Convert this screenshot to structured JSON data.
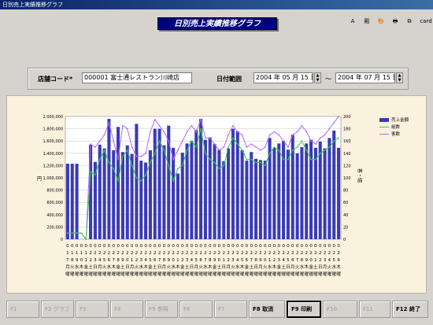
{
  "window": {
    "title": "日別売上実績推移グラフ"
  },
  "banner": "日別売上実績推移グラフ",
  "toolbar": [
    {
      "icon": "zoom-icon",
      "label": "A",
      "wide": false
    },
    {
      "icon": "font-icon",
      "label": "殿",
      "wide": false
    },
    {
      "icon": "paint-icon",
      "label": "🎨",
      "wide": false
    },
    {
      "icon": "printer-icon",
      "label": "🖶",
      "wide": false
    },
    {
      "icon": "copy-icon",
      "label": "⧉",
      "wide": false
    },
    {
      "icon": "card-icon",
      "label": "card",
      "wide": true
    }
  ],
  "filters": {
    "store_label": "店舗コード*",
    "store_value": "000001 富士通レストラン川崎店",
    "date_label": "日付範囲",
    "date_from": "2004 年 05 月 15 日",
    "tilde": "～",
    "date_to": "2004 年 07 月 15 日"
  },
  "colors": {
    "bar": "#3b3bb5",
    "line1": "#2ecc40",
    "line2": "#b266ff",
    "bg": "#fbf2de"
  },
  "chart_data": {
    "type": "bar",
    "ylabel_left": "円",
    "ylabel_right": "客・組",
    "ylim_left": [
      0,
      2000000
    ],
    "ylim_right": [
      0,
      200
    ],
    "yticks_left": [
      "0",
      "200,000",
      "400,000",
      "600,000",
      "800,000",
      "1,000,000",
      "1,200,000",
      "1,400,000",
      "1,600,000",
      "1,800,000",
      "2,000,000"
    ],
    "yticks_right": [
      "0",
      "20",
      "40",
      "60",
      "80",
      "100",
      "120",
      "140",
      "160",
      "180",
      "200"
    ],
    "legend": [
      "売上金額",
      "組数",
      "客数"
    ],
    "categories": [
      "0517",
      "0518",
      "0519",
      "0520",
      "0521",
      "0522",
      "0523",
      "0524",
      "0525",
      "0526",
      "0527",
      "0528",
      "0529",
      "0530",
      "0531",
      "0601",
      "0602",
      "0603",
      "0604",
      "0605",
      "0606",
      "0607",
      "0608",
      "0609",
      "0610",
      "0611",
      "0612",
      "0613",
      "0614",
      "0615",
      "0616",
      "0617",
      "0618",
      "0619",
      "0620",
      "0621",
      "0622",
      "0623",
      "0624",
      "0625",
      "0626",
      "0627",
      "0628",
      "0629",
      "0630",
      "0701",
      "0702",
      "0703",
      "0704",
      "0705",
      "0706",
      "0707",
      "0708",
      "0709",
      "0710",
      "0711",
      "0712",
      "0713",
      "0714",
      "0715"
    ],
    "x_labels_top": [
      "0",
      "0",
      "0",
      "0",
      "0",
      "0",
      "0",
      "0",
      "0",
      "0",
      "0",
      "0",
      "0",
      "0",
      "0",
      "0",
      "0",
      "0",
      "0",
      "0",
      "0",
      "0",
      "0",
      "0",
      "0",
      "0",
      "0",
      "0",
      "0",
      "0",
      "0",
      "0",
      "0",
      "0",
      "0",
      "0",
      "0",
      "0",
      "0",
      "0",
      "0",
      "0",
      "0",
      "0",
      "0",
      "0",
      "0",
      "0",
      "0",
      "0",
      "0",
      "0",
      "0",
      "0",
      "0",
      "0",
      "0",
      "0",
      "0",
      "0"
    ],
    "x_labels_mid": [
      "1",
      "1",
      "1",
      "1",
      "1",
      "2",
      "2",
      "2",
      "2",
      "2",
      "2",
      "2",
      "2",
      "2",
      "2",
      "2",
      "2",
      "2",
      "2",
      "2",
      "2",
      "2",
      "2",
      "2",
      "2",
      "2",
      "2",
      "2",
      "2",
      "2",
      "2",
      "2",
      "2",
      "2",
      "2",
      "2",
      "2",
      "2",
      "2",
      "2",
      "2",
      "2",
      "2",
      "2",
      "2",
      "2",
      "2",
      "2",
      "2",
      "2",
      "2",
      "2",
      "2",
      "2",
      "2",
      "2",
      "2",
      "2",
      "2",
      "2"
    ],
    "x_labels_bot": [
      "7",
      "8",
      "9",
      "0",
      "1",
      "2",
      "3",
      "4",
      "5",
      "6",
      "7",
      "8",
      "9",
      "0",
      "1",
      "2",
      "3",
      "4",
      "5",
      "6",
      "7",
      "8",
      "9",
      "0",
      "1",
      "2",
      "3",
      "4",
      "5",
      "6",
      "7",
      "8",
      "9",
      "0",
      "1",
      "2",
      "3",
      "4",
      "5",
      "6",
      "7",
      "8",
      "9",
      "0",
      "1",
      "2",
      "3",
      "4",
      "5",
      "6",
      "7",
      "8",
      "9",
      "0",
      "1",
      "2",
      "3",
      "4",
      "5",
      "6"
    ],
    "weekday_labels": [
      "月",
      "火",
      "水",
      "木",
      "金",
      "土",
      "日",
      "月",
      "火",
      "水",
      "木",
      "金",
      "土",
      "日",
      "月",
      "火",
      "水",
      "木",
      "金",
      "土",
      "日",
      "月",
      "火",
      "水",
      "木",
      "金",
      "土",
      "日",
      "月",
      "火",
      "水",
      "木",
      "金",
      "土",
      "日",
      "月",
      "火",
      "水",
      "木",
      "金",
      "土",
      "日",
      "月",
      "火",
      "水",
      "木",
      "金",
      "土",
      "日",
      "月",
      "火",
      "水",
      "木",
      "金",
      "土",
      "日",
      "月",
      "火",
      "水",
      "木"
    ],
    "row_label": "曜",
    "series": [
      {
        "name": "売上金額",
        "values": [
          1230000,
          1230000,
          1230000,
          0,
          0,
          1540000,
          1260000,
          1540000,
          1480000,
          1960000,
          1450000,
          1830000,
          1420000,
          1530000,
          1390000,
          1880000,
          1280000,
          1250000,
          1450000,
          1800000,
          1800000,
          1530000,
          1850000,
          1490000,
          1070000,
          1410000,
          1560000,
          1600000,
          1780000,
          1960000,
          1620000,
          1660000,
          1550000,
          1460000,
          1270000,
          1480000,
          1800000,
          1760000,
          1450000,
          1280000,
          1420000,
          1310000,
          1290000,
          1280000,
          1650000,
          1490000,
          1560000,
          1600000,
          1460000,
          1700000,
          1400000,
          1500000,
          1560000,
          1620000,
          1490000,
          1590000,
          1480000,
          1650000,
          1770000,
          1490000
        ]
      },
      {
        "name": "組数",
        "values": [
          10,
          10,
          10,
          10,
          0,
          110,
          105,
          130,
          145,
          125,
          115,
          95,
          135,
          145,
          120,
          100,
          95,
          105,
          125,
          140,
          160,
          145,
          120,
          95,
          115,
          120,
          145,
          160,
          150,
          180,
          140,
          130,
          125,
          115,
          120,
          150,
          165,
          155,
          145,
          130,
          130,
          125,
          125,
          120,
          140,
          150,
          145,
          130,
          130,
          145,
          150,
          160,
          145,
          130,
          130,
          140,
          145,
          150,
          160,
          165
        ]
      },
      {
        "name": "客数",
        "values": [
          10,
          10,
          10,
          10,
          0,
          155,
          150,
          160,
          170,
          190,
          160,
          130,
          185,
          180,
          150,
          135,
          135,
          140,
          175,
          195,
          185,
          175,
          160,
          130,
          145,
          160,
          175,
          185,
          175,
          195,
          165,
          165,
          155,
          145,
          150,
          170,
          185,
          175,
          170,
          150,
          155,
          150,
          145,
          150,
          170,
          175,
          170,
          160,
          150,
          170,
          175,
          185,
          175,
          160,
          155,
          165,
          170,
          180,
          190,
          200
        ]
      }
    ]
  },
  "function_keys": [
    {
      "label": "F1",
      "enabled": false
    },
    {
      "label": "F2 グラフ",
      "enabled": false
    },
    {
      "label": "F3",
      "enabled": false
    },
    {
      "label": "F4",
      "enabled": false
    },
    {
      "label": "F5 参照",
      "enabled": false
    },
    {
      "label": "F6",
      "enabled": false
    },
    {
      "label": "F7",
      "enabled": false
    },
    {
      "label": "F8 取消",
      "enabled": true
    },
    {
      "label": "F9 印刷",
      "enabled": true
    },
    {
      "label": "F10",
      "enabled": false
    },
    {
      "label": "F11",
      "enabled": false
    },
    {
      "label": "F12 終了",
      "enabled": true
    }
  ]
}
